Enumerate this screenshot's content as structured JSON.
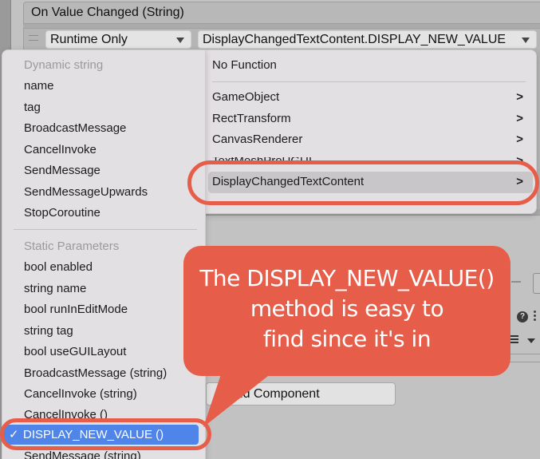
{
  "event": {
    "title": "On Value Changed (String)",
    "runtime_dropdown": {
      "value": "Runtime Only"
    },
    "function_dropdown": {
      "value": "DisplayChangedTextContent.DISPLAY_NEW_VALUE"
    }
  },
  "left_menu": {
    "dynamic_heading": "Dynamic string",
    "dynamic_items": [
      "name",
      "tag",
      "BroadcastMessage",
      "CancelInvoke",
      "SendMessage",
      "SendMessageUpwards",
      "StopCoroutine"
    ],
    "static_heading": "Static Parameters",
    "static_items": [
      "bool enabled",
      "string name",
      "bool runInEditMode",
      "string tag",
      "bool useGUILayout",
      "BroadcastMessage (string)",
      "CancelInvoke (string)",
      "CancelInvoke ()"
    ],
    "selected_item": {
      "check": "✓",
      "label": "DISPLAY_NEW_VALUE ()"
    },
    "after_selected": "SendMessage (string)"
  },
  "right_menu": {
    "no_function": "No Function",
    "items": [
      {
        "label": "GameObject",
        "chevron": ">"
      },
      {
        "label": "RectTransform",
        "chevron": ">"
      },
      {
        "label": "CanvasRenderer",
        "chevron": ">"
      },
      {
        "label": "TextMeshProUGUI",
        "chevron": ">"
      },
      {
        "label": "DisplayChangedTextContent",
        "chevron": ">"
      }
    ]
  },
  "inspector": {
    "add_component": "Add Component",
    "help_icon": "?"
  },
  "annotation": {
    "callout_text": [
      "The DISPLAY_NEW_VALUE()",
      "method is easy to",
      "find since it's in"
    ],
    "color": "#e65d49"
  },
  "colors": {
    "selection": "#4f84e9",
    "menu_bg": "#e3e0e3",
    "panel_bg": "#c2c2c2"
  }
}
